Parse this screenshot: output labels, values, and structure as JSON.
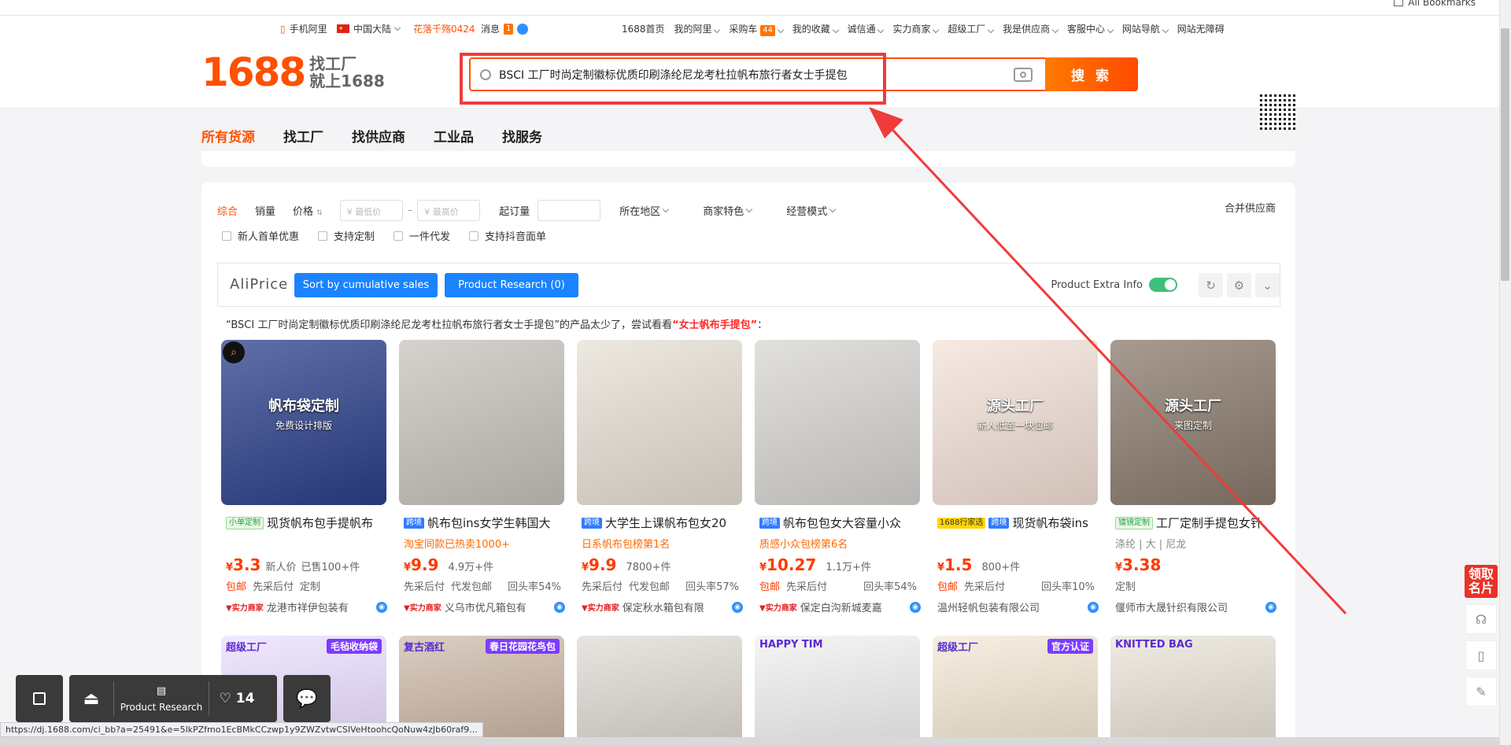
{
  "browser": {
    "bookmarks_label": "All Bookmarks"
  },
  "topnav": {
    "left": [
      {
        "label": "手机阿里",
        "icon": "phone-icon"
      },
      {
        "label": "中国大陆",
        "icon": "china-flag-icon"
      },
      {
        "label": "花落千殇0424"
      },
      {
        "label": "消息"
      },
      {
        "badge": "1"
      }
    ],
    "right": [
      "1688首页",
      "我的阿里",
      "采购车",
      "我的收藏",
      "诚信通",
      "实力商家",
      "超级工厂",
      "我是供应商",
      "客服中心",
      "网站导航",
      "网站无障碍"
    ],
    "cart_count": "44"
  },
  "logo": {
    "number": "1688",
    "slogan_line1": "找工厂",
    "slogan_line2": "就上1688"
  },
  "search": {
    "query": "BSCI 工厂时尚定制徽标优质印刷涤纶尼龙考杜拉帆布旅行者女士手提包",
    "button": "搜 索"
  },
  "category_tabs": [
    {
      "label": "所有货源",
      "active": true
    },
    {
      "label": "找工厂"
    },
    {
      "label": "找供应商"
    },
    {
      "label": "工业品"
    },
    {
      "label": "找服务"
    }
  ],
  "sort": {
    "items": [
      "综合",
      "销量",
      "价格"
    ],
    "min_price_placeholder": "¥ 最低价",
    "max_price_placeholder": "¥ 最高价",
    "moq_label": "起订量",
    "filters": [
      "所在地区",
      "商家特色",
      "经营模式"
    ],
    "merge": "合并供应商"
  },
  "checks": [
    "新人首单优惠",
    "支持定制",
    "一件代发",
    "支持抖音面单"
  ],
  "aliprice": {
    "brand": "AliPrice",
    "sort_btn": "Sort by cumulative sales",
    "research_btn": "Product Research (0)",
    "extra_label": "Product Extra Info"
  },
  "suggestion": {
    "prefix": "“BSCI 工厂时尚定制徽标优质印刷涤纶尼龙考杜拉帆布旅行者女士手提包”的产品太少了，尝试看看",
    "keyword": "“女士帆布手提包”",
    "suffix": "："
  },
  "products": [
    {
      "tags": [
        {
          "text": "小单定制",
          "style": "green"
        }
      ],
      "title": "现货帆布包手提帆布",
      "sub": "",
      "price": "3.3",
      "price_note": "新人价",
      "sold": "已售100+件",
      "svc": [
        "包邮",
        "先采后付",
        "定制"
      ],
      "rr": "",
      "strength": "实力商家",
      "shop": "龙港市祥伊包装有",
      "img_text": "帆布袋定制",
      "img_sub": "免费设计排版",
      "bg": "#2b3f8a"
    },
    {
      "tags": [
        {
          "text": "跨境",
          "style": "blue"
        }
      ],
      "title": "帆布包ins女学生韩国大",
      "sub": "淘宝同款已热卖1000+",
      "price": "9.9",
      "price_note": "",
      "sold": "4.9万+件",
      "svc": [
        "先采后付",
        "代发包邮"
      ],
      "rr": "回头率54%",
      "strength": "实力商家",
      "shop": "义乌市优凡箱包有",
      "img_text": "",
      "img_sub": "",
      "bg": "#c8c3bd"
    },
    {
      "tags": [
        {
          "text": "跨境",
          "style": "blue"
        }
      ],
      "title": "大学生上课帆布包女20",
      "sub": "日系帆布包榜第1名",
      "price": "9.9",
      "price_note": "",
      "sold": "7800+件",
      "svc": [
        "先采后付",
        "代发包邮"
      ],
      "rr": "回头率57%",
      "strength": "实力商家",
      "shop": "保定秋水箱包有限",
      "img_text": "",
      "img_sub": "",
      "bg": "#e8e1d6"
    },
    {
      "tags": [
        {
          "text": "跨境",
          "style": "blue"
        }
      ],
      "title": "帆布包包女大容量小众",
      "sub": "质感小众包榜第6名",
      "price": "10.27",
      "price_note": "",
      "sold": "1.1万+件",
      "svc": [
        "包邮",
        "先采后付"
      ],
      "rr": "回头率54%",
      "strength": "实力商家",
      "shop": "保定白沟新城麦嘉",
      "img_text": "",
      "img_sub": "",
      "bg": "#d8d6d2"
    },
    {
      "tags": [
        {
          "text": "1688行家选",
          "style": "yellow"
        },
        {
          "text": "跨境",
          "style": "blue"
        }
      ],
      "title": "现货帆布袋ins",
      "sub": "",
      "price": "1.5",
      "price_note": "",
      "sold": "800+件",
      "svc": [
        "包邮",
        "先采后付"
      ],
      "rr": "回头率10%",
      "strength": "",
      "shop": "温州轻帆包装有限公司",
      "img_text": "源头工厂",
      "img_sub": "新人低至一块包邮",
      "bg": "#f4e3d8"
    },
    {
      "tags": [
        {
          "text": "镭镜定制",
          "style": "green"
        }
      ],
      "title": "工厂定制手提包女针",
      "sub": "涤纶 | 大 | 尼龙",
      "price": "3.38",
      "price_note": "",
      "sold": "",
      "svc": [
        "定制"
      ],
      "rr": "",
      "strength": "",
      "shop": "偃师市大晟针织有限公司",
      "img_text": "源头工厂",
      "img_sub": "来图定制",
      "bg": "#8a7a6d"
    }
  ],
  "row2": [
    {
      "badge": "超级工厂",
      "badge2": "毛毡收纳袋",
      "bg": "#e9dcff"
    },
    {
      "badge": "复古酒红",
      "badge2": "春日花园花鸟包",
      "bg": "#c9b3a2"
    },
    {
      "badge": "",
      "badge2": "",
      "bg": "#dcd6cf"
    },
    {
      "badge": "HAPPY TIM",
      "badge2": "",
      "bg": "#efefef"
    },
    {
      "badge": "超级工厂",
      "badge2": "官方认证",
      "bg": "#f1e6d1"
    },
    {
      "badge": "KNITTED BAG",
      "badge2": "",
      "bg": "#e6e0d4"
    }
  ],
  "bottombar": {
    "research": "Product Research",
    "likes": "14"
  },
  "status_url": "https://dj.1688.com/ci_bb?a=25491&e=5lkPZfmo1EcBMkCCzwp1y9ZWZvtwCSlVeHtoohcQoNuw4zJb60raf9...",
  "sidebar": {
    "gift": "领取名片"
  }
}
